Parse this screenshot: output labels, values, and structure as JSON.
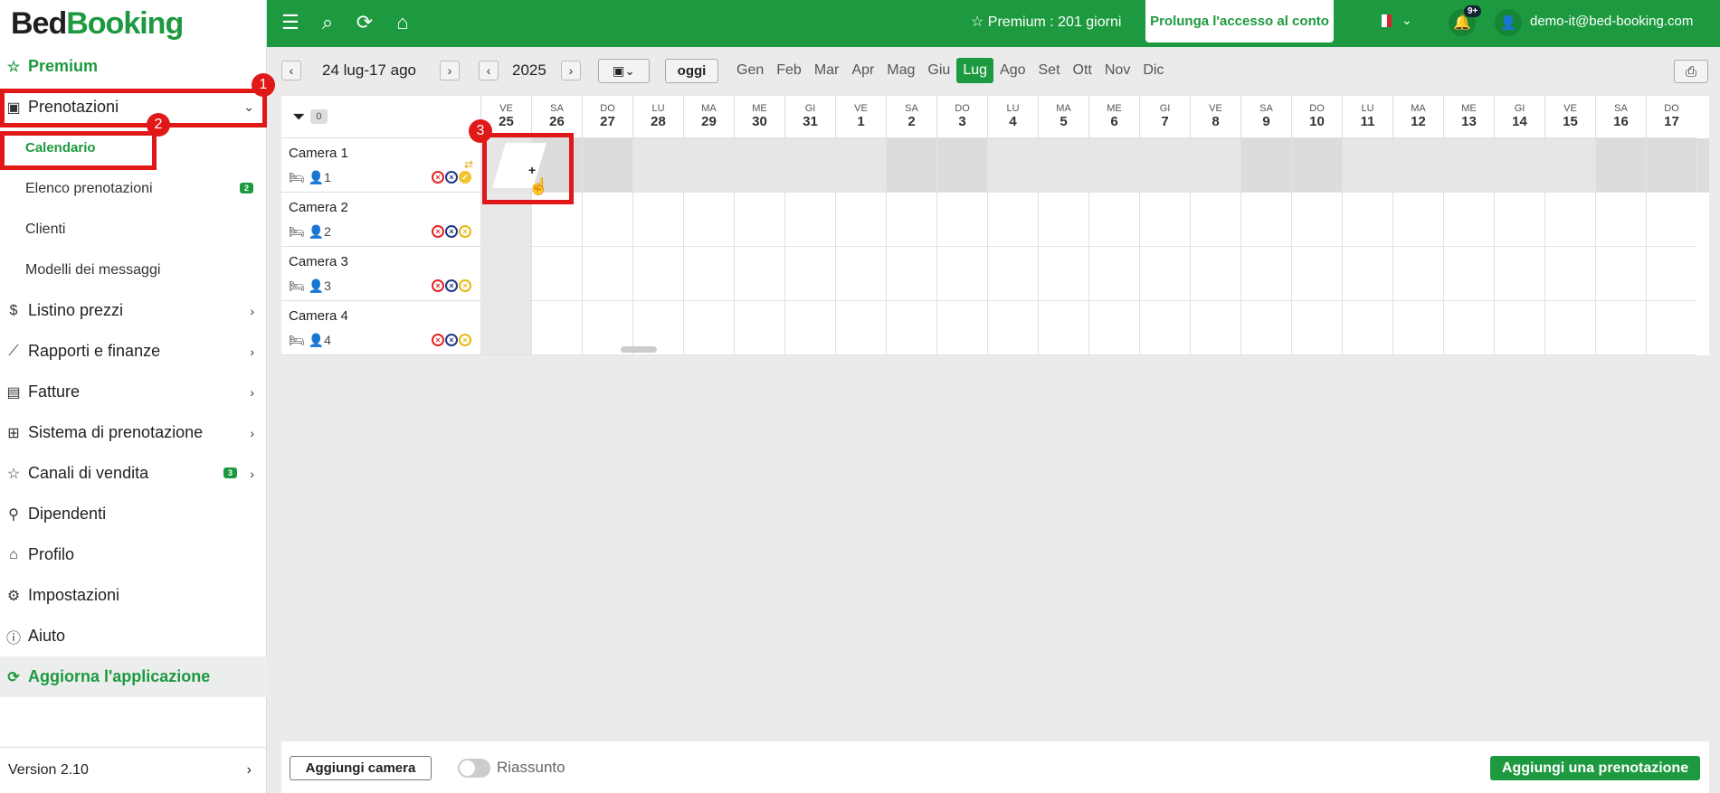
{
  "brand": {
    "part1": "Bed",
    "part2": "Booking"
  },
  "sidebar": {
    "premium": "Premium",
    "prenotazioni": "Prenotazioni",
    "sub": [
      "Calendario",
      "Elenco prenotazioni",
      "Clienti",
      "Modelli dei messaggi"
    ],
    "elenco_badge": "2",
    "items": [
      "Listino prezzi",
      "Rapporti e finanze",
      "Fatture",
      "Sistema di prenotazione",
      "Canali di vendita",
      "Dipendenti",
      "Profilo",
      "Impostazioni",
      "Aiuto"
    ],
    "canali_badge": "3",
    "update": "Aggiorna l'applicazione",
    "version": "Version 2.10"
  },
  "topbar": {
    "premium": "Premium : 201 giorni",
    "prolunga": "Prolunga l'accesso al conto",
    "notifications": "9+",
    "user_email": "demo-it@bed-booking.com"
  },
  "toolbar": {
    "range": "24 lug-17 ago",
    "year": "2025",
    "today": "oggi",
    "months": [
      "Gen",
      "Feb",
      "Mar",
      "Apr",
      "Mag",
      "Giu",
      "Lug",
      "Ago",
      "Set",
      "Ott",
      "Nov",
      "Dic"
    ],
    "active_month": "Lug"
  },
  "calendar": {
    "filter_count": "0",
    "days": [
      {
        "n": "VE",
        "d": "25"
      },
      {
        "n": "SA",
        "d": "26"
      },
      {
        "n": "DO",
        "d": "27"
      },
      {
        "n": "LU",
        "d": "28"
      },
      {
        "n": "MA",
        "d": "29"
      },
      {
        "n": "ME",
        "d": "30"
      },
      {
        "n": "GI",
        "d": "31"
      },
      {
        "n": "VE",
        "d": "1"
      },
      {
        "n": "SA",
        "d": "2"
      },
      {
        "n": "DO",
        "d": "3"
      },
      {
        "n": "LU",
        "d": "4"
      },
      {
        "n": "MA",
        "d": "5"
      },
      {
        "n": "ME",
        "d": "6"
      },
      {
        "n": "GI",
        "d": "7"
      },
      {
        "n": "VE",
        "d": "8"
      },
      {
        "n": "SA",
        "d": "9"
      },
      {
        "n": "DO",
        "d": "10"
      },
      {
        "n": "LU",
        "d": "11"
      },
      {
        "n": "MA",
        "d": "12"
      },
      {
        "n": "ME",
        "d": "13"
      },
      {
        "n": "GI",
        "d": "14"
      },
      {
        "n": "VE",
        "d": "15"
      },
      {
        "n": "SA",
        "d": "16"
      },
      {
        "n": "DO",
        "d": "17"
      }
    ],
    "rooms": [
      {
        "name": "Camera 1",
        "guests": "1"
      },
      {
        "name": "Camera 2",
        "guests": "2"
      },
      {
        "name": "Camera 3",
        "guests": "3"
      },
      {
        "name": "Camera 4",
        "guests": "4"
      }
    ],
    "new_booking_plus": "+"
  },
  "annotations": [
    "1",
    "2",
    "3"
  ],
  "bottombar": {
    "add_room": "Aggiungi camera",
    "summary": "Riassunto",
    "add_reservation": "Aggiungi una prenotazione"
  }
}
